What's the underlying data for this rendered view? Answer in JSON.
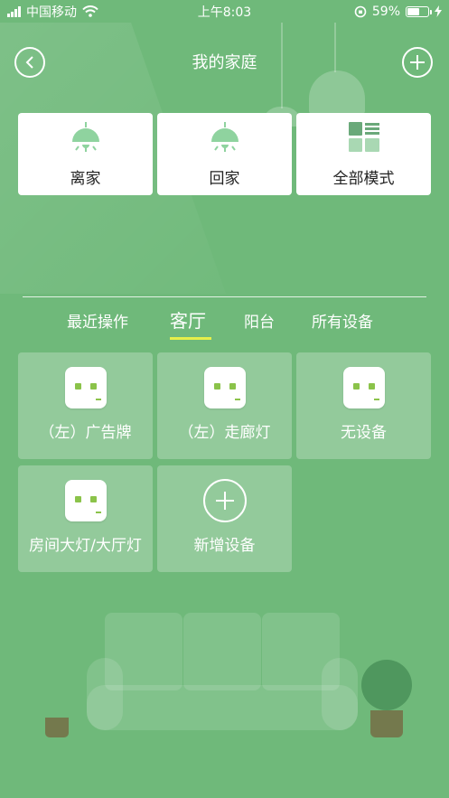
{
  "status_bar": {
    "carrier": "中国移动",
    "time": "上午8:03",
    "battery": "59%"
  },
  "header": {
    "title": "我的家庭",
    "back_icon": "chevron-left-icon",
    "add_icon": "plus-icon"
  },
  "modes": [
    {
      "label": "离家",
      "icon": "ceiling-lamp-icon"
    },
    {
      "label": "回家",
      "icon": "ceiling-lamp-icon"
    },
    {
      "label": "全部模式",
      "icon": "grid-list-icon"
    }
  ],
  "tabs": [
    {
      "label": "最近操作",
      "active": false
    },
    {
      "label": "客厅",
      "active": true
    },
    {
      "label": "阳台",
      "active": false
    },
    {
      "label": "所有设备",
      "active": false
    }
  ],
  "devices": [
    {
      "label": "（左）广告牌",
      "icon": "smart-socket-icon"
    },
    {
      "label": "（左）走廊灯",
      "icon": "smart-socket-icon"
    },
    {
      "label": "无设备",
      "icon": "smart-socket-icon"
    },
    {
      "label": "房间大灯/大厅灯",
      "icon": "smart-socket-icon"
    },
    {
      "label": "新增设备",
      "icon": "plus-circle-icon"
    }
  ],
  "colors": {
    "background": "#6fb97a",
    "accent_green": "#8bc34a",
    "tab_underline": "#e6ef4a"
  }
}
